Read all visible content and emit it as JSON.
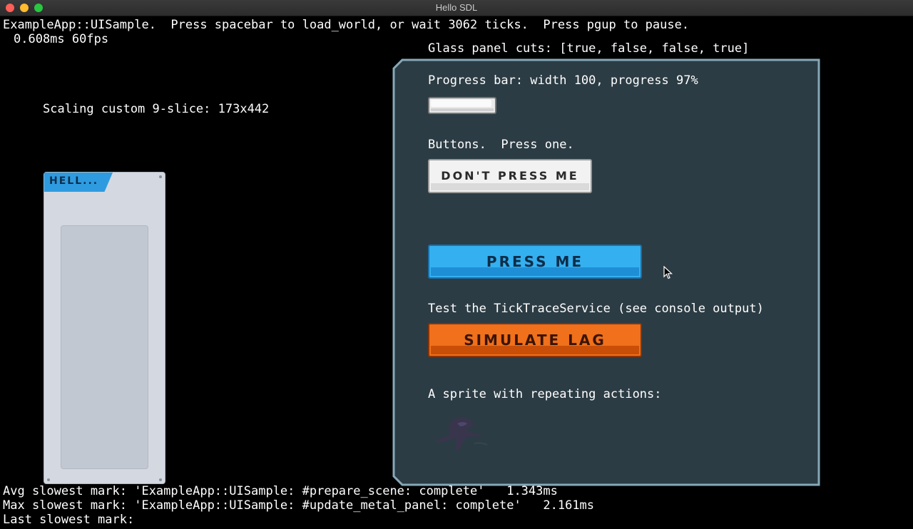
{
  "window": {
    "title": "Hello SDL"
  },
  "header": {
    "line1": "ExampleApp::UISample.  Press spacebar to load_world, or wait 3062 ticks.  Press pgup to pause.",
    "perf": "0.608ms 60fps"
  },
  "glass_label": "Glass panel cuts: [true, false, false, true]",
  "scaling": {
    "label": "Scaling custom 9-slice: 173x442",
    "tab_title": "HELL..."
  },
  "progress": {
    "label": "Progress bar: width 100, progress 97%",
    "value": 0.97
  },
  "buttons": {
    "label": "Buttons.  Press one.",
    "dont_press": "DON'T PRESS ME",
    "press": "PRESS ME"
  },
  "tick": {
    "label": "Test the TickTraceService (see console output)",
    "simulate": "SIMULATE LAG"
  },
  "sprite_label": "A sprite with repeating actions:",
  "footer": {
    "avg": "Avg slowest mark: 'ExampleApp::UISample: #prepare_scene: complete'   1.343ms",
    "max": "Max slowest mark: 'ExampleApp::UISample: #update_metal_panel: complete'   2.161ms",
    "last": "Last slowest mark:"
  },
  "colors": {
    "panel_fill": "#2c3c44",
    "panel_border": "#86a9b9",
    "blue_button": "#34b0f0",
    "orange_button": "#f0701c"
  },
  "icons": [
    "close-icon",
    "minimize-icon",
    "maximize-icon",
    "mouse-cursor-icon",
    "sprite-creature-icon"
  ]
}
